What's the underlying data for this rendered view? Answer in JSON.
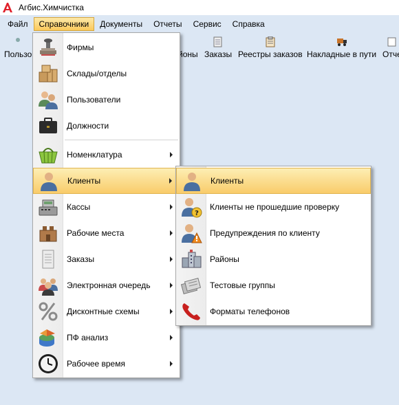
{
  "window": {
    "title": "Агбис.Химчистка"
  },
  "menubar": {
    "items": [
      {
        "label": "Файл"
      },
      {
        "label": "Справочники",
        "active": true
      },
      {
        "label": "Документы"
      },
      {
        "label": "Отчеты"
      },
      {
        "label": "Сервис"
      },
      {
        "label": "Справка"
      }
    ]
  },
  "toolbar": {
    "items": [
      {
        "label": "Пользо"
      },
      {
        "label": "йоны"
      },
      {
        "label": "Заказы"
      },
      {
        "label": "Реестры заказов"
      },
      {
        "label": "Накладные в пути"
      },
      {
        "label": "Отче"
      }
    ]
  },
  "references_menu": {
    "items": [
      {
        "label": "Фирмы",
        "icon": "firm-stamp-icon"
      },
      {
        "label": "Склады/отделы",
        "icon": "warehouse-boxes-icon"
      },
      {
        "label": "Пользователи",
        "icon": "users-icon"
      },
      {
        "label": "Должности",
        "icon": "briefcase-icon"
      },
      {
        "label": "Номенклатура",
        "icon": "basket-icon",
        "submenu": true
      },
      {
        "label": "Клиенты",
        "icon": "client-icon",
        "submenu": true,
        "highlighted": true
      },
      {
        "label": "Кассы",
        "icon": "cash-register-icon",
        "submenu": true
      },
      {
        "label": "Рабочие места",
        "icon": "workplace-icon",
        "submenu": true
      },
      {
        "label": "Заказы",
        "icon": "orders-icon",
        "submenu": true
      },
      {
        "label": "Электронная очередь",
        "icon": "queue-icon",
        "submenu": true
      },
      {
        "label": "Дисконтные схемы",
        "icon": "percent-icon",
        "submenu": true
      },
      {
        "label": "ПФ анализ",
        "icon": "analysis-icon",
        "submenu": true
      },
      {
        "label": "Рабочее время",
        "icon": "clock-icon",
        "submenu": true
      }
    ]
  },
  "clients_submenu": {
    "items": [
      {
        "label": "Клиенты",
        "icon": "client-icon",
        "highlighted": true
      },
      {
        "label": "Клиенты не прошедшие проверку",
        "icon": "client-question-icon"
      },
      {
        "label": "Предупреждения по клиенту",
        "icon": "client-warning-icon"
      },
      {
        "label": "Районы",
        "icon": "district-buildings-icon"
      },
      {
        "label": "Тестовые группы",
        "icon": "test-groups-icon"
      },
      {
        "label": "Форматы телефонов",
        "icon": "phone-icon"
      }
    ]
  },
  "colors": {
    "accent": "#fbc95c",
    "background": "#dce7f4"
  }
}
